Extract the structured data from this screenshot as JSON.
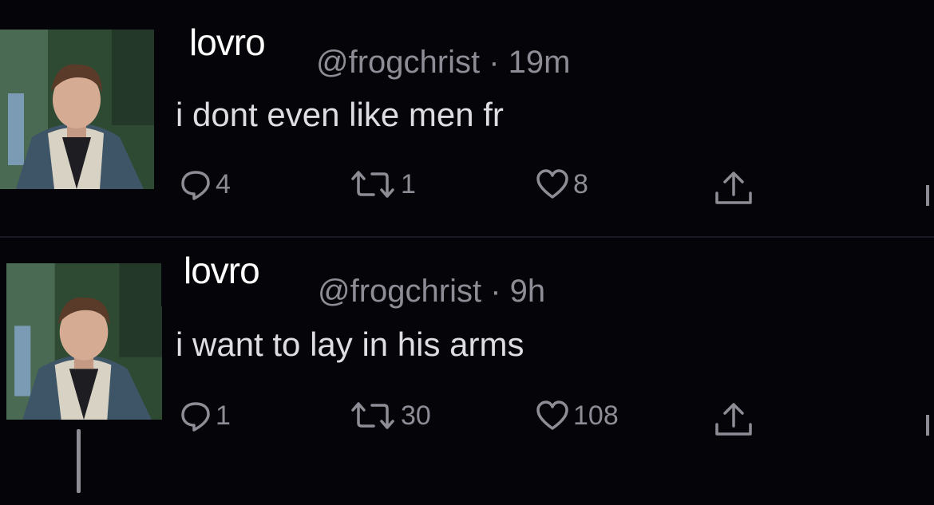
{
  "tweets": [
    {
      "name": "lovro",
      "handle": "@frogchrist · 19m",
      "text": "i dont even like men fr",
      "replies": "4",
      "retweets": "1",
      "likes": "8"
    },
    {
      "name": "lovro",
      "handle": "@frogchrist · 9h",
      "text": "i want to lay in his arms",
      "replies": "1",
      "retweets": "30",
      "likes": "108"
    }
  ],
  "icons": [
    "avatar-photo",
    "reply-icon",
    "retweet-icon",
    "like-icon",
    "share-icon"
  ],
  "colors": {
    "background": "#050409",
    "muted": "#8e8c95",
    "text": "#dedde2",
    "name": "#ffffff"
  }
}
